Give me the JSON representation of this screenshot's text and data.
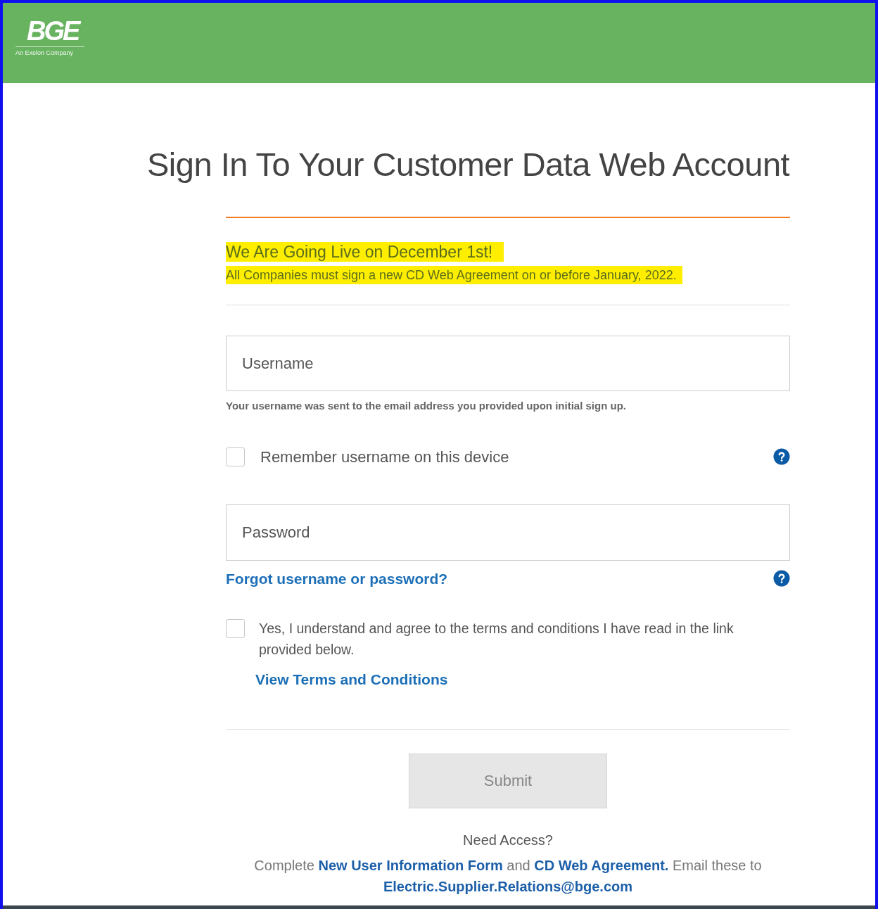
{
  "header": {
    "logo": "BGE",
    "tagline": "An Exelon Company"
  },
  "title": "Sign In To Your Customer Data Web Account",
  "notice": {
    "heading": "We Are Going Live on December 1st!",
    "text": "All Companies must sign a new CD Web Agreement on or before January, 2022."
  },
  "username": {
    "placeholder": "Username",
    "hint": "Your username was sent to the email address you provided upon initial sign up."
  },
  "remember": {
    "label": "Remember username on this device",
    "checked": false
  },
  "password": {
    "placeholder": "Password"
  },
  "forgot_link": "Forgot username or password?",
  "terms": {
    "label": "Yes, I understand and agree to the terms and conditions I have read in the link provided below.",
    "checked": false,
    "link": "View Terms and Conditions"
  },
  "submit": {
    "label": "Submit",
    "disabled": true
  },
  "footer": {
    "heading": "Need Access?",
    "parts": [
      {
        "kind": "text",
        "text": "Complete "
      },
      {
        "kind": "link",
        "text": "New User Information Form"
      },
      {
        "kind": "text",
        "text": " and "
      },
      {
        "kind": "link",
        "text": "CD Web Agreement."
      },
      {
        "kind": "text",
        "text": " Email these to "
      },
      {
        "kind": "link",
        "text": "Electric.Supplier.Relations@bge.com"
      }
    ]
  }
}
